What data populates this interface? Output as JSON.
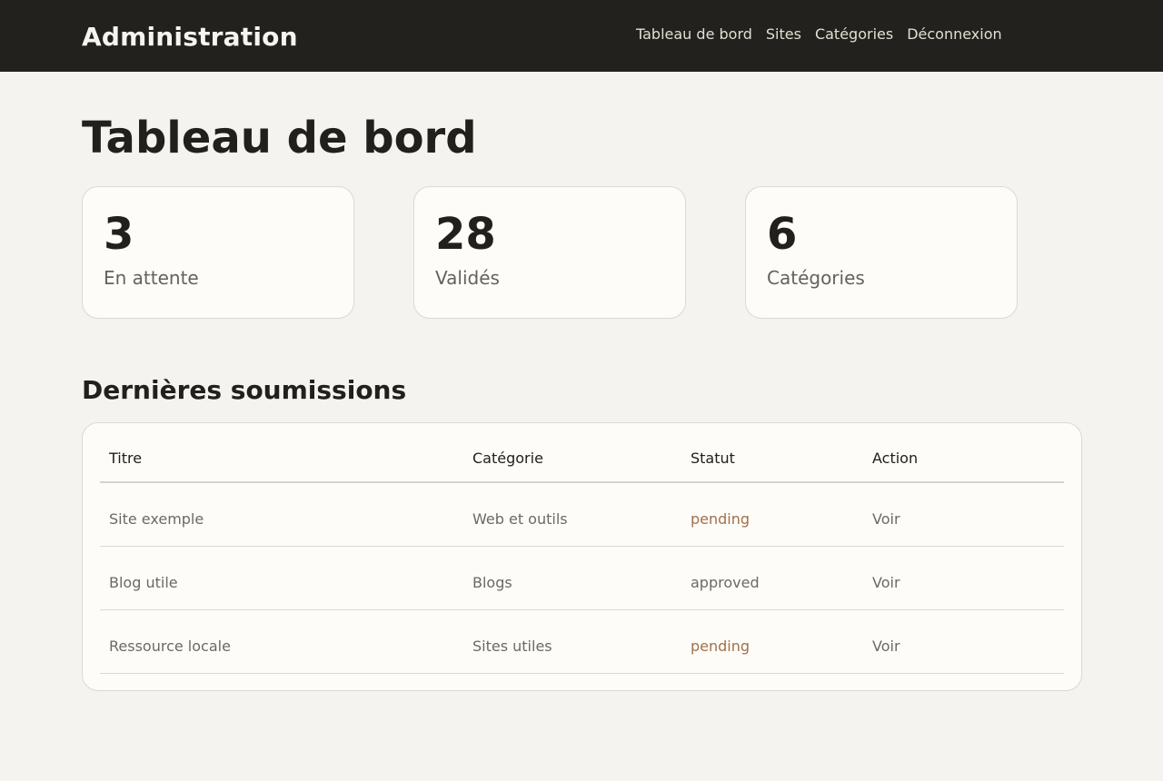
{
  "header": {
    "brand": "Administration",
    "nav": [
      "Tableau de bord",
      "Sites",
      "Catégories",
      "Déconnexion"
    ]
  },
  "page": {
    "title": "Tableau de bord"
  },
  "stats": [
    {
      "value": "3",
      "label": "En attente"
    },
    {
      "value": "28",
      "label": "Validés"
    },
    {
      "value": "6",
      "label": "Catégories"
    }
  ],
  "submissions": {
    "title": "Dernières soumissions",
    "columns": [
      "Titre",
      "Catégorie",
      "Statut",
      "Action"
    ],
    "rows": [
      {
        "title": "Site exemple",
        "category": "Web et outils",
        "status": "pending",
        "action": "Voir"
      },
      {
        "title": "Blog utile",
        "category": "Blogs",
        "status": "approved",
        "action": "Voir"
      },
      {
        "title": "Ressource locale",
        "category": "Sites utiles",
        "status": "pending",
        "action": "Voir"
      }
    ]
  },
  "colors": {
    "header_bg": "#23211d",
    "page_bg": "#f4f3ef",
    "card_bg": "#fdfcf8",
    "pending": "#a2704a"
  }
}
